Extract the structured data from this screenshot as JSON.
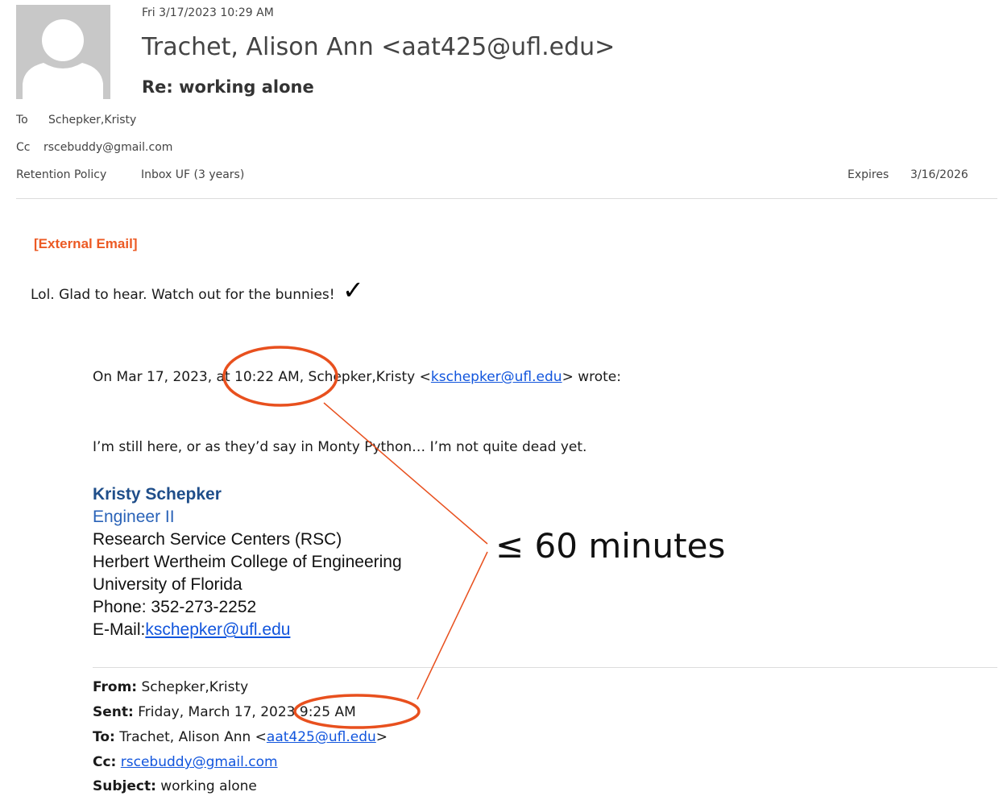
{
  "header": {
    "date": "Fri 3/17/2023 10:29 AM",
    "from": "Trachet, Alison Ann <aat425@ufl.edu>",
    "subject": "Re: working alone"
  },
  "meta": {
    "to_label": "To",
    "to_value": "Schepker,Kristy",
    "cc_label": "Cc",
    "cc_value": "rscebuddy@gmail.com",
    "retention_label": "Retention Policy",
    "retention_value": "Inbox UF (3 years)",
    "expires_label": "Expires",
    "expires_value": "3/16/2026"
  },
  "body": {
    "external_tag": "[External Email]",
    "reply_text": "Lol.  Glad to hear.  Watch out for the bunnies!",
    "checkmark": "✓",
    "quote_prefix": "On Mar 17, 2023, at 10:22 AM, Schepker,Kristy <",
    "quote_email": "kschepker@ufl.edu",
    "quote_suffix": "> wrote:",
    "quoted_message": "I’m still here, or as they’d say in Monty Python… I’m not quite dead yet."
  },
  "signature": {
    "name": "Kristy Schepker",
    "title": "Engineer II",
    "org1": "Research Service Centers (RSC)",
    "org2": "Herbert Wertheim College of Engineering",
    "org3": "University of Florida",
    "phone": "Phone: 352-273-2252",
    "email_label": "E-Mail:",
    "email": "kschepker@ufl.edu"
  },
  "original": {
    "from_label": "From:",
    "from_value": "Schepker,Kristy",
    "sent_label": "Sent:",
    "sent_value": "Friday, March 17, 2023 9:25 AM",
    "to_label": "To:",
    "to_name": "Trachet, Alison Ann <",
    "to_email": "aat425@ufl.edu",
    "to_close": ">",
    "cc_label": "Cc:",
    "cc_value": "rscebuddy@gmail.com",
    "subject_label": "Subject:",
    "subject_value": "working alone"
  },
  "annotation": {
    "label": "≤ 60 minutes",
    "color": "#e8501e"
  },
  "colors": {
    "external_tag": "#ec5a24",
    "signature_name": "#1f4e8a",
    "signature_title": "#2a63b8",
    "link": "#1155dd",
    "avatar_bg": "#c8c8c8"
  },
  "icons": {
    "avatar": "person-silhouette-icon",
    "check": "checkmark-icon"
  }
}
